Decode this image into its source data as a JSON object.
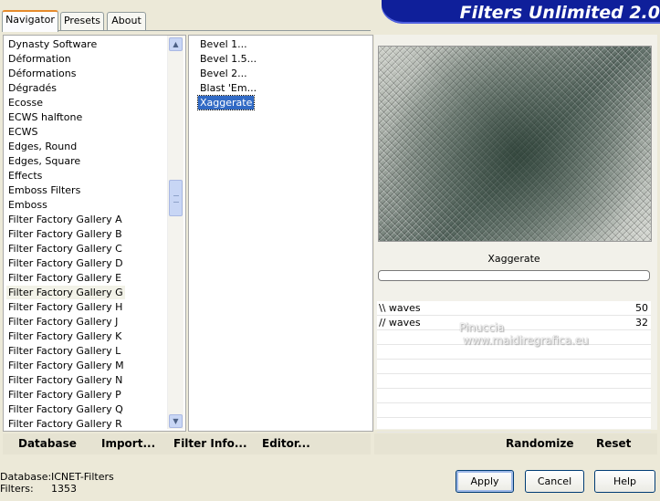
{
  "tabs": [
    "Navigator",
    "Presets",
    "About"
  ],
  "banner_title": "Filters Unlimited 2.0",
  "categories": [
    "Dynasty Software",
    "Déformation",
    "Déformations",
    "Dégradés",
    "Ecosse",
    "ECWS halftone",
    "ECWS",
    "Edges, Round",
    "Edges, Square",
    "Effects",
    "Emboss Filters",
    "Emboss",
    "Filter Factory Gallery A",
    "Filter Factory Gallery B",
    "Filter Factory Gallery C",
    "Filter Factory Gallery D",
    "Filter Factory Gallery E",
    "Filter Factory Gallery G",
    "Filter Factory Gallery H",
    "Filter Factory Gallery J",
    "Filter Factory Gallery K",
    "Filter Factory Gallery L",
    "Filter Factory Gallery M",
    "Filter Factory Gallery N",
    "Filter Factory Gallery P",
    "Filter Factory Gallery Q",
    "Filter Factory Gallery R"
  ],
  "highlighted_category_index": 17,
  "filters": [
    "Bevel 1...",
    "Bevel 1.5...",
    "Bevel 2...",
    "Blast 'Em...",
    "Xaggerate"
  ],
  "selected_filter_index": 4,
  "preview": {
    "filter_name": "Xaggerate"
  },
  "parameters": [
    {
      "name": "\\\\ waves",
      "value": "50"
    },
    {
      "name": "// waves",
      "value": "32"
    }
  ],
  "watermark": {
    "line1": "Pinuccia",
    "line2": "www.maidiregrafica.eu"
  },
  "left_bar": [
    "Database",
    "Import...",
    "Filter Info...",
    "Editor..."
  ],
  "right_bar": [
    "Randomize",
    "Reset"
  ],
  "buttons": {
    "apply": "Apply",
    "cancel": "Cancel",
    "help": "Help"
  },
  "status": {
    "database_label": "Database:",
    "database_value": "ICNET-Filters",
    "filters_label": "Filters:",
    "filters_value": "1353"
  }
}
